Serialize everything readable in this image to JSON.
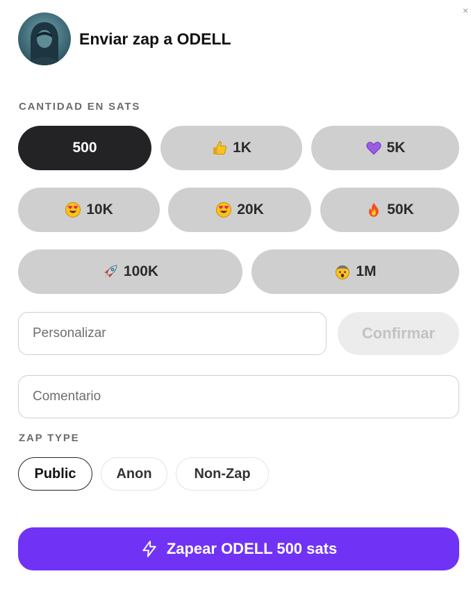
{
  "dialog": {
    "title": "Enviar zap a ODELL",
    "close_icon": "close-icon",
    "avatar_icon": "hooded-figure-avatar"
  },
  "amount": {
    "label": "CANTIDAD EN SATS",
    "selected": "500",
    "options": [
      {
        "label": "500",
        "emoji": ""
      },
      {
        "label": "1K",
        "emoji": "thumbs-up"
      },
      {
        "label": "5K",
        "emoji": "purple-heart"
      },
      {
        "label": "10K",
        "emoji": "heart-eyes"
      },
      {
        "label": "20K",
        "emoji": "heart-eyes"
      },
      {
        "label": "50K",
        "emoji": "fire"
      },
      {
        "label": "100K",
        "emoji": "rocket"
      },
      {
        "label": "1M",
        "emoji": "mind-blown"
      }
    ]
  },
  "custom": {
    "placeholder": "Personalizar",
    "confirm_label": "Confirmar"
  },
  "comment": {
    "placeholder": "Comentario"
  },
  "zap_type": {
    "label": "ZAP TYPE",
    "selected": "Public",
    "options": [
      "Public",
      "Anon",
      "Non-Zap"
    ]
  },
  "submit": {
    "label": "Zapear ODELL 500 sats",
    "icon": "lightning-bolt-icon"
  },
  "colors": {
    "accent": "#7033f5",
    "selected_amount": "#232326",
    "amount_button": "#cfcfcf"
  }
}
